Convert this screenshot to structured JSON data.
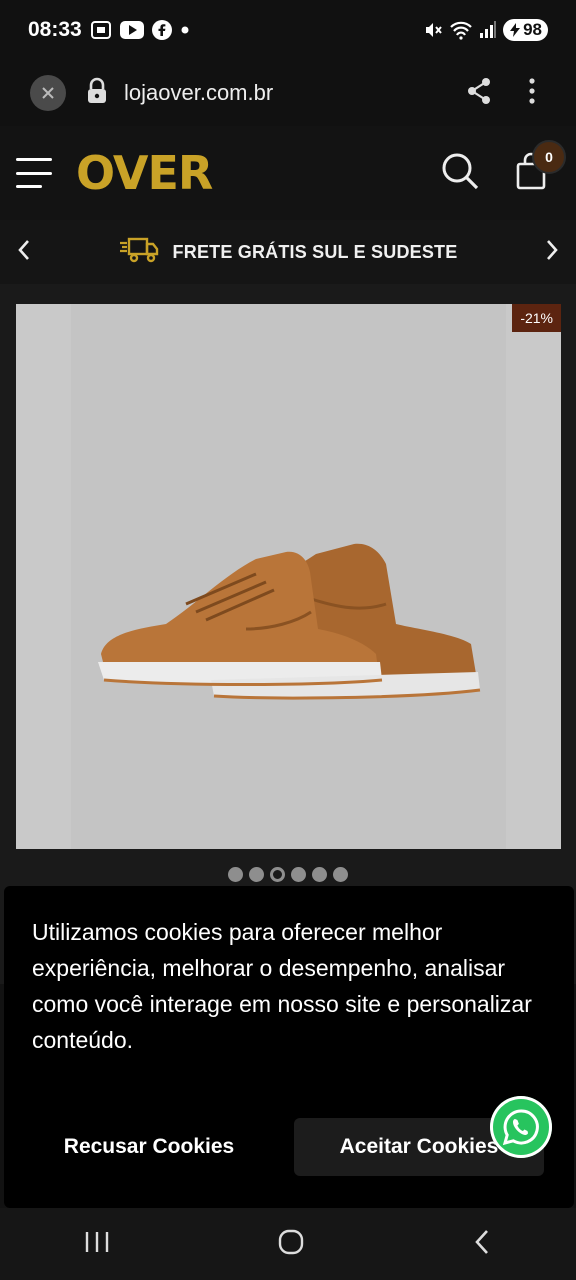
{
  "status_bar": {
    "time": "08:33",
    "battery": "98"
  },
  "browser": {
    "url": "lojaover.com.br"
  },
  "header": {
    "logo": "OVER",
    "cart_count": "0"
  },
  "promo": {
    "text": "FRETE GRÁTIS SUL E SUDESTE"
  },
  "product": {
    "discount": "-21%",
    "gallery": {
      "count": 6,
      "active": 3
    }
  },
  "cookies": {
    "message": "Utilizamos cookies para oferecer melhor experiência, melhorar o desempenho, analisar como você interage em nosso site e personalizar conteúdo.",
    "refuse_label": "Recusar Cookies",
    "accept_label": "Aceitar Cookies"
  },
  "colors": {
    "brand": "#c9a227",
    "badge": "#5c2410",
    "whatsapp": "#27c45e",
    "shoe": "#b06c35"
  }
}
